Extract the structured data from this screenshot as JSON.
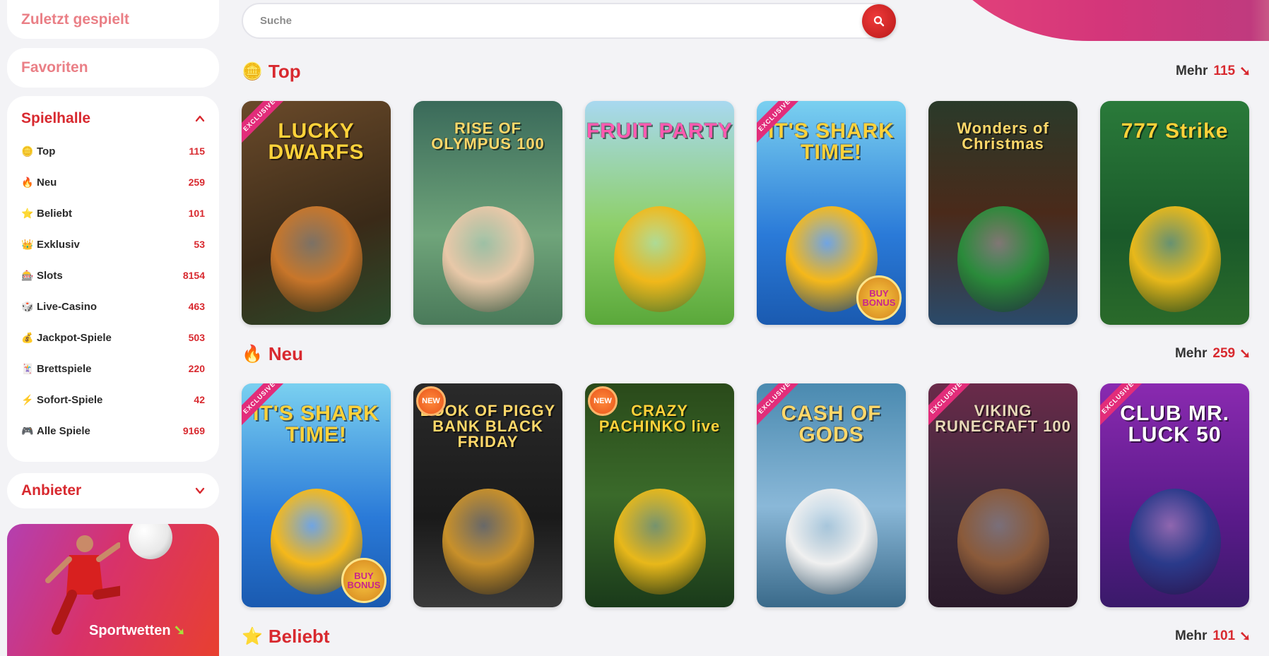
{
  "sidebar": {
    "recent": "Zuletzt gespielt",
    "favorites": "Favoriten",
    "hall": {
      "title": "Spielhalle",
      "items": [
        {
          "icon": "🪙",
          "label": "Top",
          "count": "115"
        },
        {
          "icon": "🔥",
          "label": "Neu",
          "count": "259"
        },
        {
          "icon": "⭐",
          "label": "Beliebt",
          "count": "101"
        },
        {
          "icon": "👑",
          "label": "Exklusiv",
          "count": "53"
        },
        {
          "icon": "🎰",
          "label": "Slots",
          "count": "8154"
        },
        {
          "icon": "🎲",
          "label": "Live-Casino",
          "count": "463"
        },
        {
          "icon": "💰",
          "label": "Jackpot-Spiele",
          "count": "503"
        },
        {
          "icon": "🃏",
          "label": "Brettspiele",
          "count": "220"
        },
        {
          "icon": "⚡",
          "label": "Sofort-Spiele",
          "count": "42"
        },
        {
          "icon": "🎮",
          "label": "Alle Spiele",
          "count": "9169"
        }
      ]
    },
    "providers": "Anbieter",
    "sports_banner": "Sportwetten"
  },
  "search": {
    "placeholder": "Suche"
  },
  "sections": [
    {
      "title": "Top",
      "icon": "🪙",
      "more": "Mehr",
      "count": "115",
      "games": [
        {
          "title": "LUCKY DWARFS",
          "tag": "EXCLUSIVE"
        },
        {
          "title": "RISE OF OLYMPUS 100",
          "tag": ""
        },
        {
          "title": "FRUIT PARTY",
          "tag": ""
        },
        {
          "title": "IT'S SHARK TIME!",
          "tag": "EXCLUSIVE",
          "badge": "BUY BONUS"
        },
        {
          "title": "Wonders of Christmas",
          "tag": ""
        },
        {
          "title": "777 Strike",
          "tag": ""
        }
      ]
    },
    {
      "title": "Neu",
      "icon": "🔥",
      "more": "Mehr",
      "count": "259",
      "games": [
        {
          "title": "IT'S SHARK TIME!",
          "tag": "EXCLUSIVE",
          "badge": "BUY BONUS"
        },
        {
          "title": "BOOK OF PIGGY BANK BLACK FRIDAY",
          "tag": "",
          "new": "NEW"
        },
        {
          "title": "CRAZY PACHINKO live",
          "tag": "",
          "new": "NEW"
        },
        {
          "title": "CASH OF GODS",
          "tag": "EXCLUSIVE"
        },
        {
          "title": "VIKING RUNECRAFT 100",
          "tag": "EXCLUSIVE"
        },
        {
          "title": "CLUB MR. LUCK 50",
          "tag": "EXCLUSIVE"
        }
      ]
    },
    {
      "title": "Beliebt",
      "icon": "⭐",
      "more": "Mehr",
      "count": "101"
    }
  ]
}
